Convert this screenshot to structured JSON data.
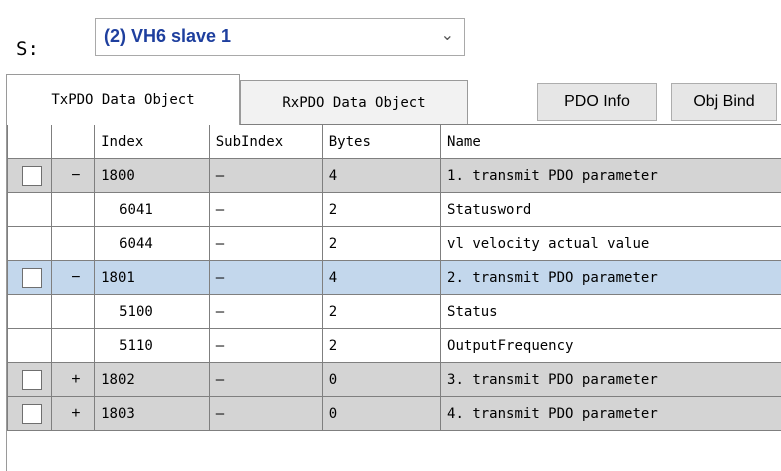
{
  "slave": {
    "label": "S:",
    "selected": "(2)  VH6 slave 1",
    "chevron_icon": "chevron-down-icon"
  },
  "tabs": [
    {
      "label": "TxPDO Data Object",
      "active": true
    },
    {
      "label": "RxPDO Data Object",
      "active": false
    }
  ],
  "buttons": {
    "pdo_info": "PDO Info",
    "obj_bind": "Obj Bind"
  },
  "table": {
    "columns": [
      "",
      "",
      "Index",
      "SubIndex",
      "Bytes",
      "Name"
    ],
    "rows": [
      {
        "type": "group",
        "expander": "−",
        "index": "1800",
        "subindex": "—",
        "bytes": "4",
        "name": "1. transmit PDO parameter",
        "selected": false
      },
      {
        "type": "child",
        "index": "6041",
        "subindex": "—",
        "bytes": "2",
        "name": "Statusword"
      },
      {
        "type": "child",
        "index": "6044",
        "subindex": "—",
        "bytes": "2",
        "name": "vl velocity actual value"
      },
      {
        "type": "group",
        "expander": "−",
        "index": "1801",
        "subindex": "—",
        "bytes": "4",
        "name": "2. transmit PDO parameter",
        "selected": true
      },
      {
        "type": "child",
        "index": "5100",
        "subindex": "—",
        "bytes": "2",
        "name": "Status"
      },
      {
        "type": "child",
        "index": "5110",
        "subindex": "—",
        "bytes": "2",
        "name": "OutputFrequency"
      },
      {
        "type": "group",
        "expander": "+",
        "index": "1802",
        "subindex": "—",
        "bytes": "0",
        "name": "3. transmit PDO parameter",
        "selected": false
      },
      {
        "type": "group",
        "expander": "+",
        "index": "1803",
        "subindex": "—",
        "bytes": "0",
        "name": "4. transmit PDO parameter",
        "selected": false
      }
    ]
  },
  "colors": {
    "selected_row": "#c3d7ec",
    "group_row": "#d4d4d4",
    "slave_text": "#1e3f9e"
  }
}
